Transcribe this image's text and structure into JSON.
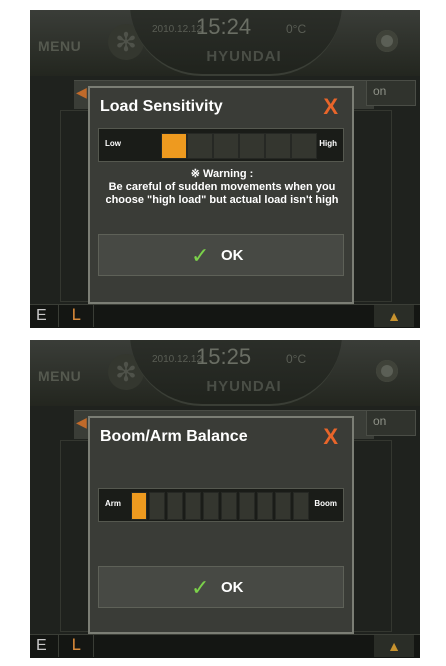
{
  "screens": [
    {
      "topbar": {
        "menu_label": "MENU",
        "date": "2010.12.12",
        "time": "15:24",
        "temperature": "0°C",
        "brand": "HYUNDAI"
      },
      "background": {
        "tab_partial_label": "on"
      },
      "dialog": {
        "title": "Load Sensitivity",
        "close_icon": "close-icon",
        "meter": {
          "low_label": "Low",
          "high_label": "High",
          "segments_total": 6,
          "segments_active": 1
        },
        "warning_title": "※ Warning :",
        "warning_line1": "Be careful of sudden movements when you",
        "warning_line2": "choose \"high load\" but actual load isn't high",
        "ok_label": "OK"
      },
      "bottombar": {
        "mode_letter": "E"
      }
    },
    {
      "topbar": {
        "menu_label": "MENU",
        "date": "2010.12.12",
        "time": "15:25",
        "temperature": "0°C",
        "brand": "HYUNDAI"
      },
      "background": {
        "tab_partial_label": "on"
      },
      "dialog": {
        "title": "Boom/Arm Balance",
        "close_icon": "close-icon",
        "meter": {
          "left_label": "Arm",
          "right_label": "Boom",
          "segments_total": 10,
          "segments_active": 1
        },
        "ok_label": "OK"
      },
      "bottombar": {
        "mode_letter": "E"
      }
    }
  ],
  "colors": {
    "accent_orange": "#ee9a1f",
    "close_orange": "#e8652a",
    "check_green": "#7bd14a"
  }
}
